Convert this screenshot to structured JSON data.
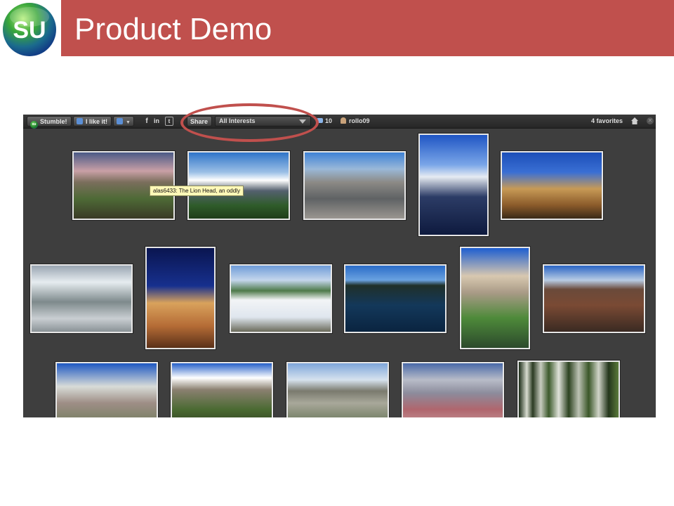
{
  "slide": {
    "title": "Product Demo",
    "logo_text": "SU"
  },
  "toolbar": {
    "stumble_label": "Stumble!",
    "like_label": "I like it!",
    "share_label": "Share",
    "interests_value": "All Interests",
    "comments_count": "10",
    "username": "rollo09",
    "favorites_label": "4 favorites",
    "social": [
      "f",
      "in",
      "t"
    ]
  },
  "tooltip": {
    "text": "alas6433: The Lion Head, an oddly"
  },
  "colors": {
    "header": "#c0504d",
    "screen_bg": "#3e3e3e",
    "highlight": "#c0504d",
    "tooltip_bg": "#fff9b8"
  },
  "photos": [
    {
      "subject": "alpine-sunset-boulders"
    },
    {
      "subject": "lion-head-mountain"
    },
    {
      "subject": "granite-basin-lake"
    },
    {
      "subject": "mountain-tarn-reflection"
    },
    {
      "subject": "desert-cliffs-clouds"
    },
    {
      "subject": "snowy-forest-slopes"
    },
    {
      "subject": "canyon-wall-night"
    },
    {
      "subject": "snowfield-lake"
    },
    {
      "subject": "calm-lake-rocks"
    },
    {
      "subject": "rock-spires-creek"
    },
    {
      "subject": "silversword-plant"
    },
    {
      "subject": "white-cliffs-bluesky"
    },
    {
      "subject": "rocky-hills-clouds"
    },
    {
      "subject": "desert-range-shrubs"
    },
    {
      "subject": "painted-hills"
    },
    {
      "subject": "aspen-grove"
    }
  ]
}
